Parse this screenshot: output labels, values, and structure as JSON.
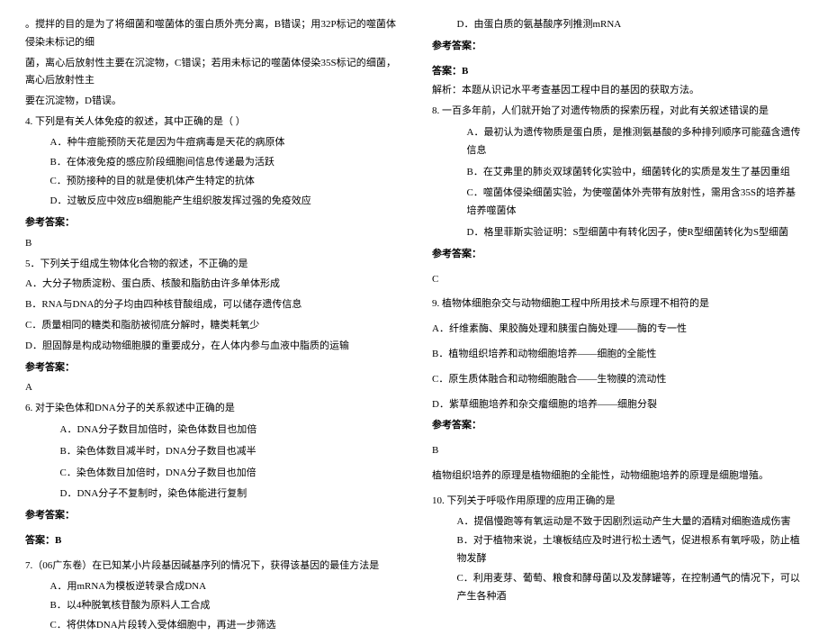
{
  "left": {
    "intro_line1": "。搅拌的目的是为了将细菌和噬菌体的蛋白质外壳分离，B错误；用32P标记的噬菌体侵染未标记的细",
    "intro_line2": "菌，离心后放射性主要在沉淀物，C错误；若用未标记的噬菌体侵染35S标记的细菌，离心后放射性主",
    "intro_line3": "要在沉淀物，D错误。",
    "q4_stem": "4. 下列是有关人体免疫的叙述，其中正确的是（  ）",
    "q4_a": "A．种牛痘能预防天花是因为牛痘病毒是天花的病原体",
    "q4_b": "B．在体液免疫的感应阶段细胞间信息传递最为活跃",
    "q4_c": "C．预防接种的目的就是使机体产生特定的抗体",
    "q4_d": "D．过敏反应中效应B细胞能产生组织胺发挥过强的免疫效应",
    "ref_label": "参考答案：",
    "q4_ans": "B",
    "q5_stem": "5．下列关于组成生物体化合物的叙述，不正确的是",
    "q5_a": "A．大分子物质淀粉、蛋白质、核酸和脂肪由许多单体形成",
    "q5_b": "B．RNA与DNA的分子均由四种核苷酸组成，可以储存遗传信息",
    "q5_c": "C．质量相同的糖类和脂肪被彻底分解时，糖类耗氧少",
    "q5_d": "D．胆固醇是构成动物细胞膜的重要成分，在人体内参与血液中脂质的运输",
    "q5_ans": "A",
    "q6_stem": "6. 对于染色体和DNA分子的关系叙述中正确的是",
    "q6_a": "A．DNA分子数目加倍时，染色体数目也加倍",
    "q6_b": "B．染色体数目减半时，DNA分子数目也减半",
    "q6_c": "C．染色体数目加倍时，DNA分子数目也加倍",
    "q6_d": "D．DNA分子不复制时，染色体能进行复制",
    "q6_ans": "答案：B",
    "q7_stem": "7.（06广东卷）在已知某小片段基因碱基序列的情况下，获得该基因的最佳方法是",
    "q7_a": "A．用mRNA为模板逆转录合成DNA",
    "q7_b": "B．以4种脱氧核苷酸为原料人工合成",
    "q7_c": "C．将供体DNA片段转入受体细胞中，再进一步筛选"
  },
  "right": {
    "q7_d": "D．由蛋白质的氨基酸序列推测mRNA",
    "ref_label": "参考答案：",
    "q7_ans": "答案：B",
    "q7_exp": "解析：本题从识记水平考查基因工程中目的基因的获取方法。",
    "q8_stem": "8. 一百多年前，人们就开始了对遗传物质的探索历程，对此有关叙述错误的是",
    "q8_a": "A．最初认为遗传物质是蛋白质，是推测氨基酸的多种排列顺序可能蕴含遗传信息",
    "q8_b": "B．在艾弗里的肺炎双球菌转化实验中，细菌转化的实质是发生了基因重组",
    "q8_c": "C．噬菌体侵染细菌实验，为使噬菌体外壳带有放射性，需用含35S的培养基培养噬菌体",
    "q8_d": "D．格里菲斯实验证明：S型细菌中有转化因子，使R型细菌转化为S型细菌",
    "q8_ans": "C",
    "q9_stem": "9. 植物体细胞杂交与动物细胞工程中所用技术与原理不相符的是",
    "q9_a": "A．纤维素酶、果胶酶处理和胰蛋白酶处理——酶的专一性",
    "q9_b": "B．植物组织培养和动物细胞培养——细胞的全能性",
    "q9_c": "C．原生质体融合和动物细胞融合——生物膜的流动性",
    "q9_d": "D．紫草细胞培养和杂交瘤细胞的培养——细胞分裂",
    "q9_ans": "B",
    "q9_exp": "植物组织培养的原理是植物细胞的全能性，动物细胞培养的原理是细胞增殖。",
    "q10_stem": "10. 下列关于呼吸作用原理的应用正确的是",
    "q10_a": "A．提倡慢跑等有氧运动是不致于因剧烈运动产生大量的酒精对细胞造成伤害",
    "q10_b": "B．对于植物来说，土壤板结应及时进行松土透气，促进根系有氧呼吸，防止植物发酵",
    "q10_c": "C．利用麦芽、葡萄、粮食和酵母菌以及发酵罐等，在控制通气的情况下，可以产生各种酒"
  }
}
